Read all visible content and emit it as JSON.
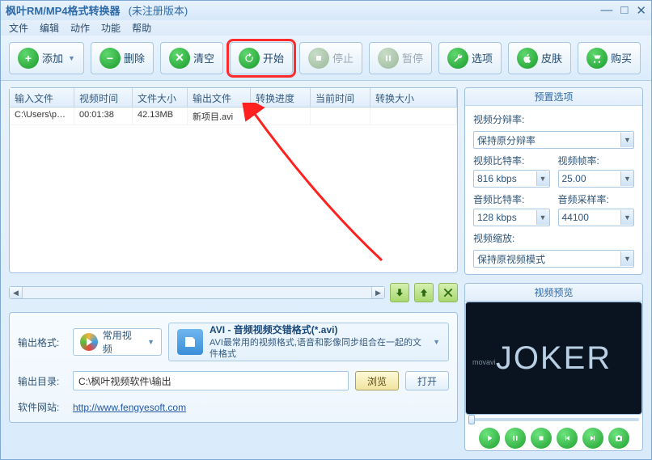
{
  "title": {
    "app": "枫叶RM/MP4格式转换器",
    "status": "(未注册版本)"
  },
  "menu": [
    "文件",
    "编辑",
    "动作",
    "功能",
    "帮助"
  ],
  "toolbar": {
    "add": "添加",
    "del": "删除",
    "clear": "清空",
    "start": "开始",
    "stop": "停止",
    "pause": "暂停",
    "options": "选项",
    "skin": "皮肤",
    "buy": "购买"
  },
  "table": {
    "headers": [
      "输入文件",
      "视频时间",
      "文件大小",
      "输出文件",
      "转换进度",
      "当前时间",
      "转换大小"
    ],
    "rows": [
      {
        "input": "C:\\Users\\pc\\...",
        "duration": "00:01:38",
        "size": "42.13MB",
        "output": "新项目.avi",
        "progress": "",
        "curtime": "",
        "outsize": ""
      }
    ]
  },
  "output": {
    "format_label": "输出格式:",
    "format_combo": "常用视频",
    "format_title": "AVI - 音频视频交错格式(*.avi)",
    "format_desc": "AVI最常用的视频格式,语音和影像同步组合在一起的文件格式",
    "dir_label": "输出目录:",
    "dir_value": "C:\\枫叶视频软件\\输出",
    "browse": "浏览",
    "open": "打开",
    "site_label": "软件网站:",
    "site_url": "http://www.fengyesoft.com"
  },
  "prefs": {
    "title": "预置选项",
    "vres_label": "视频分辩率:",
    "vres_value": "保持原分辩率",
    "vbit_label": "视频比特率:",
    "vbit_value": "816 kbps",
    "vfps_label": "视频帧率:",
    "vfps_value": "25.00",
    "abit_label": "音频比特率:",
    "abit_value": "128 kbps",
    "asr_label": "音频采样率:",
    "asr_value": "44100",
    "vzoom_label": "视频缩放:",
    "vzoom_value": "保持原视频模式"
  },
  "preview": {
    "title": "视频预览",
    "text": "JOKER",
    "watermark": "movavi"
  }
}
